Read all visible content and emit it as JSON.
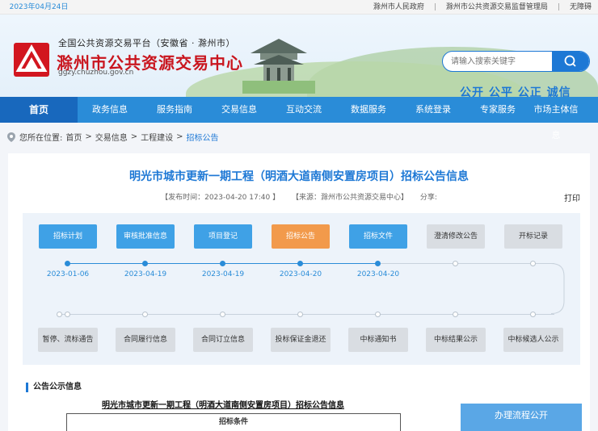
{
  "topbar": {
    "date": "2023年04月24日 星期一",
    "links": [
      "滁州市人民政府",
      "滁州市公共资源交易监督管理局",
      "无障碍"
    ]
  },
  "header": {
    "subtitle": "全国公共资源交易平台（安徽省 · 滁州市）",
    "title": "滁州市公共资源交易中心",
    "url": "ggzy.chuzhou.gov.cn",
    "search_placeholder": "请输入搜索关键字",
    "slogan": "公开 公平 公正 诚信"
  },
  "nav": [
    "首页",
    "政务信息",
    "服务指南",
    "交易信息",
    "互动交流",
    "数据服务",
    "系统登录",
    "专家服务",
    "市场主体信息"
  ],
  "breadcrumb": {
    "prefix": "您所在位置:",
    "items": [
      "首页",
      "交易信息",
      "工程建设"
    ],
    "current": "招标公告",
    "sep": ">"
  },
  "article": {
    "title": "明光市城市更新一期工程（明酒大道南侧安置房项目）招标公告信息",
    "publish_time": "【发布时间：2023-04-20 17:40 】",
    "source": "【来源：滁州市公共资源交易中心】",
    "share": "分享:",
    "print": "打印"
  },
  "flow": {
    "top_steps": [
      {
        "label": "招标计划",
        "state": "done",
        "date": "2023-01-06"
      },
      {
        "label": "审核批准信息",
        "state": "done",
        "date": "2023-04-19"
      },
      {
        "label": "项目登记",
        "state": "done",
        "date": "2023-04-19"
      },
      {
        "label": "招标公告",
        "state": "current",
        "date": "2023-04-20"
      },
      {
        "label": "招标文件",
        "state": "done",
        "date": "2023-04-20"
      },
      {
        "label": "澄清修改公告",
        "state": "todo",
        "date": ""
      },
      {
        "label": "开标记录",
        "state": "todo",
        "date": ""
      }
    ],
    "bottom_steps": [
      {
        "label": "暂停、流标通告"
      },
      {
        "label": "合同履行信息"
      },
      {
        "label": "合同订立信息"
      },
      {
        "label": "投标保证金退还"
      },
      {
        "label": "中标通知书"
      },
      {
        "label": "中标结果公示"
      },
      {
        "label": "中标候选人公示"
      }
    ]
  },
  "notice": {
    "section_title": "公告公示信息",
    "doc_title": "明光市城市更新一期工程（明酒大道南侧安置房项目）招标公告信息",
    "table_header": "招标条件"
  },
  "sidebar": {
    "process_title": "办理流程公开"
  },
  "colors": {
    "brand_blue": "#1d78d5",
    "nav_blue": "#2a8cd8",
    "current_orange": "#f29a4b",
    "title_red": "#c9151e"
  }
}
